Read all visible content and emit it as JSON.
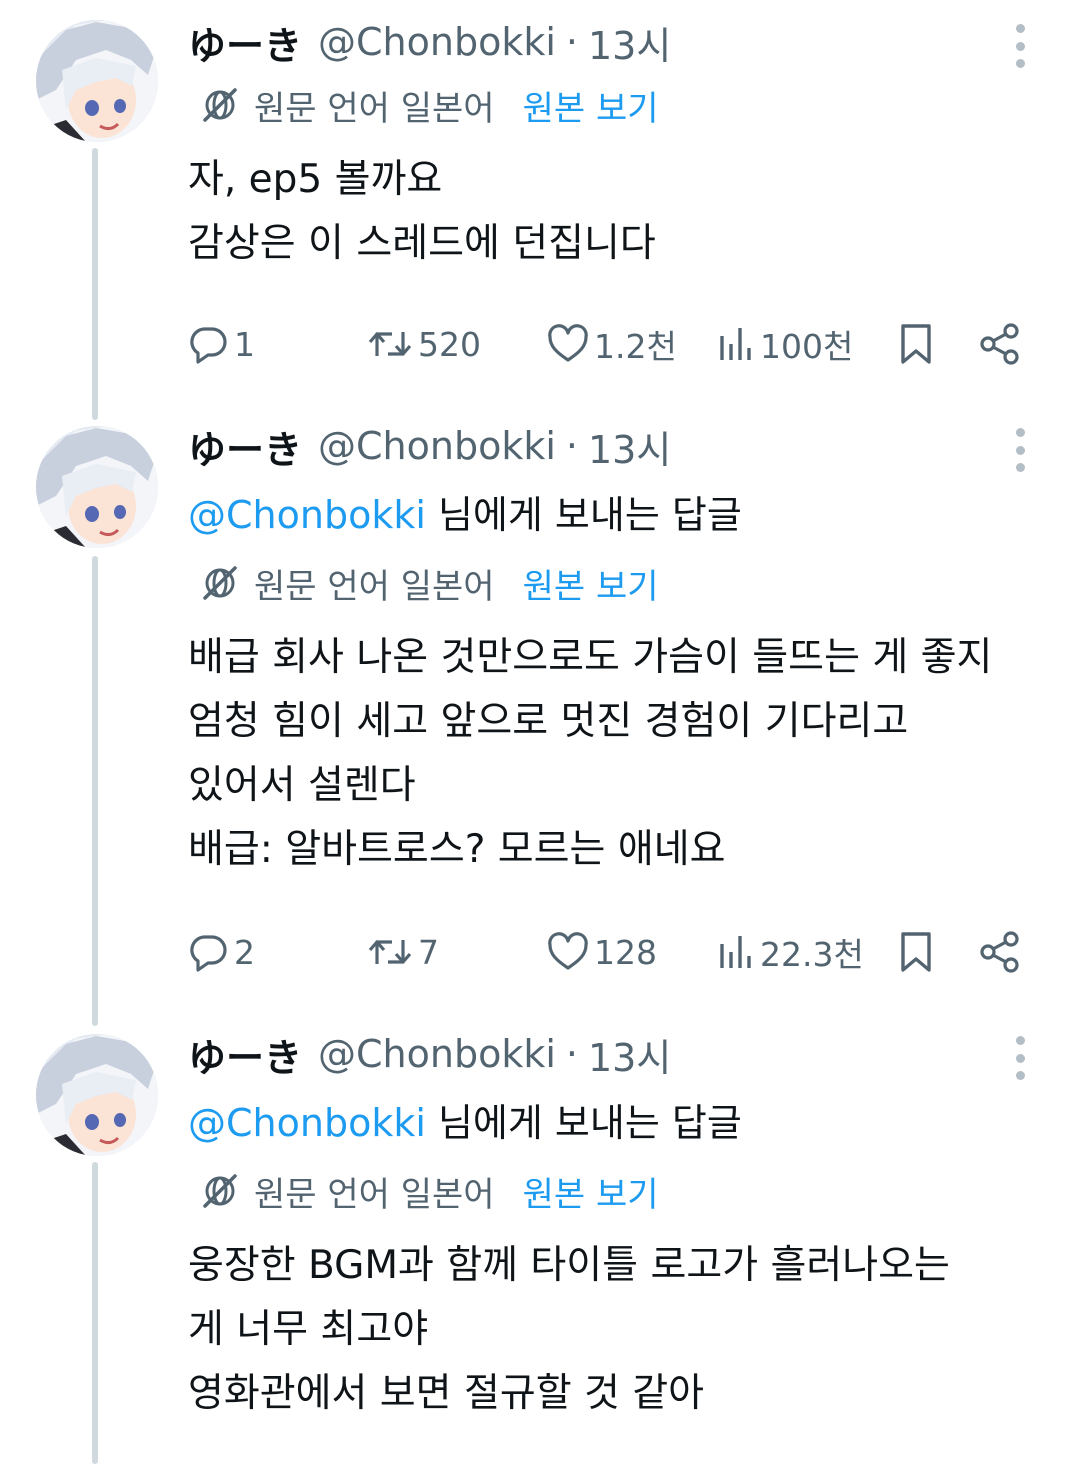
{
  "tweets": [
    {
      "display_name": "ゆーき",
      "handle": "@Chonbokki",
      "time": "13시",
      "reply_to": null,
      "translation": {
        "label": "원문 언어 일본어",
        "view_original": "원본 보기"
      },
      "lines": [
        "자, ep5 볼까요",
        "감상은 이 스레드에 던집니다"
      ],
      "stats": {
        "replies": "1",
        "retweets": "520",
        "likes": "1.2천",
        "views": "100천"
      }
    },
    {
      "display_name": "ゆーき",
      "handle": "@Chonbokki",
      "time": "13시",
      "reply_to": {
        "mention": "@Chonbokki",
        "suffix": " 님에게 보내는 답글"
      },
      "translation": {
        "label": "원문 언어 일본어",
        "view_original": "원본 보기"
      },
      "lines": [
        "배급 회사 나온 것만으로도 가슴이 들뜨는 게 좋지",
        "엄청 힘이 세고 앞으로 멋진 경험이 기다리고",
        "있어서 설렌다",
        "배급: 알바트로스? 모르는 애네요"
      ],
      "stats": {
        "replies": "2",
        "retweets": "7",
        "likes": "128",
        "views": "22.3천"
      }
    },
    {
      "display_name": "ゆーき",
      "handle": "@Chonbokki",
      "time": "13시",
      "reply_to": {
        "mention": "@Chonbokki",
        "suffix": " 님에게 보내는 답글"
      },
      "translation": {
        "label": "원문 언어 일본어",
        "view_original": "원본 보기"
      },
      "lines": [
        "웅장한 BGM과 함께 타이틀 로고가 흘러나오는",
        "게 너무 최고야",
        "영화관에서 보면 절규할 것 같아"
      ],
      "stats": null
    }
  ],
  "dot": "·",
  "icons": {
    "translate": "translate-slash-icon",
    "reply": "reply-icon",
    "retweet": "retweet-icon",
    "like": "heart-icon",
    "views": "views-bar-chart-icon",
    "bookmark": "bookmark-icon",
    "share": "share-icon",
    "more": "more-vertical-icon"
  },
  "colors": {
    "link": "#1d9bf0",
    "secondary_text": "#536471",
    "thread_line": "#cfd9de",
    "primary_text": "#0f1419"
  }
}
